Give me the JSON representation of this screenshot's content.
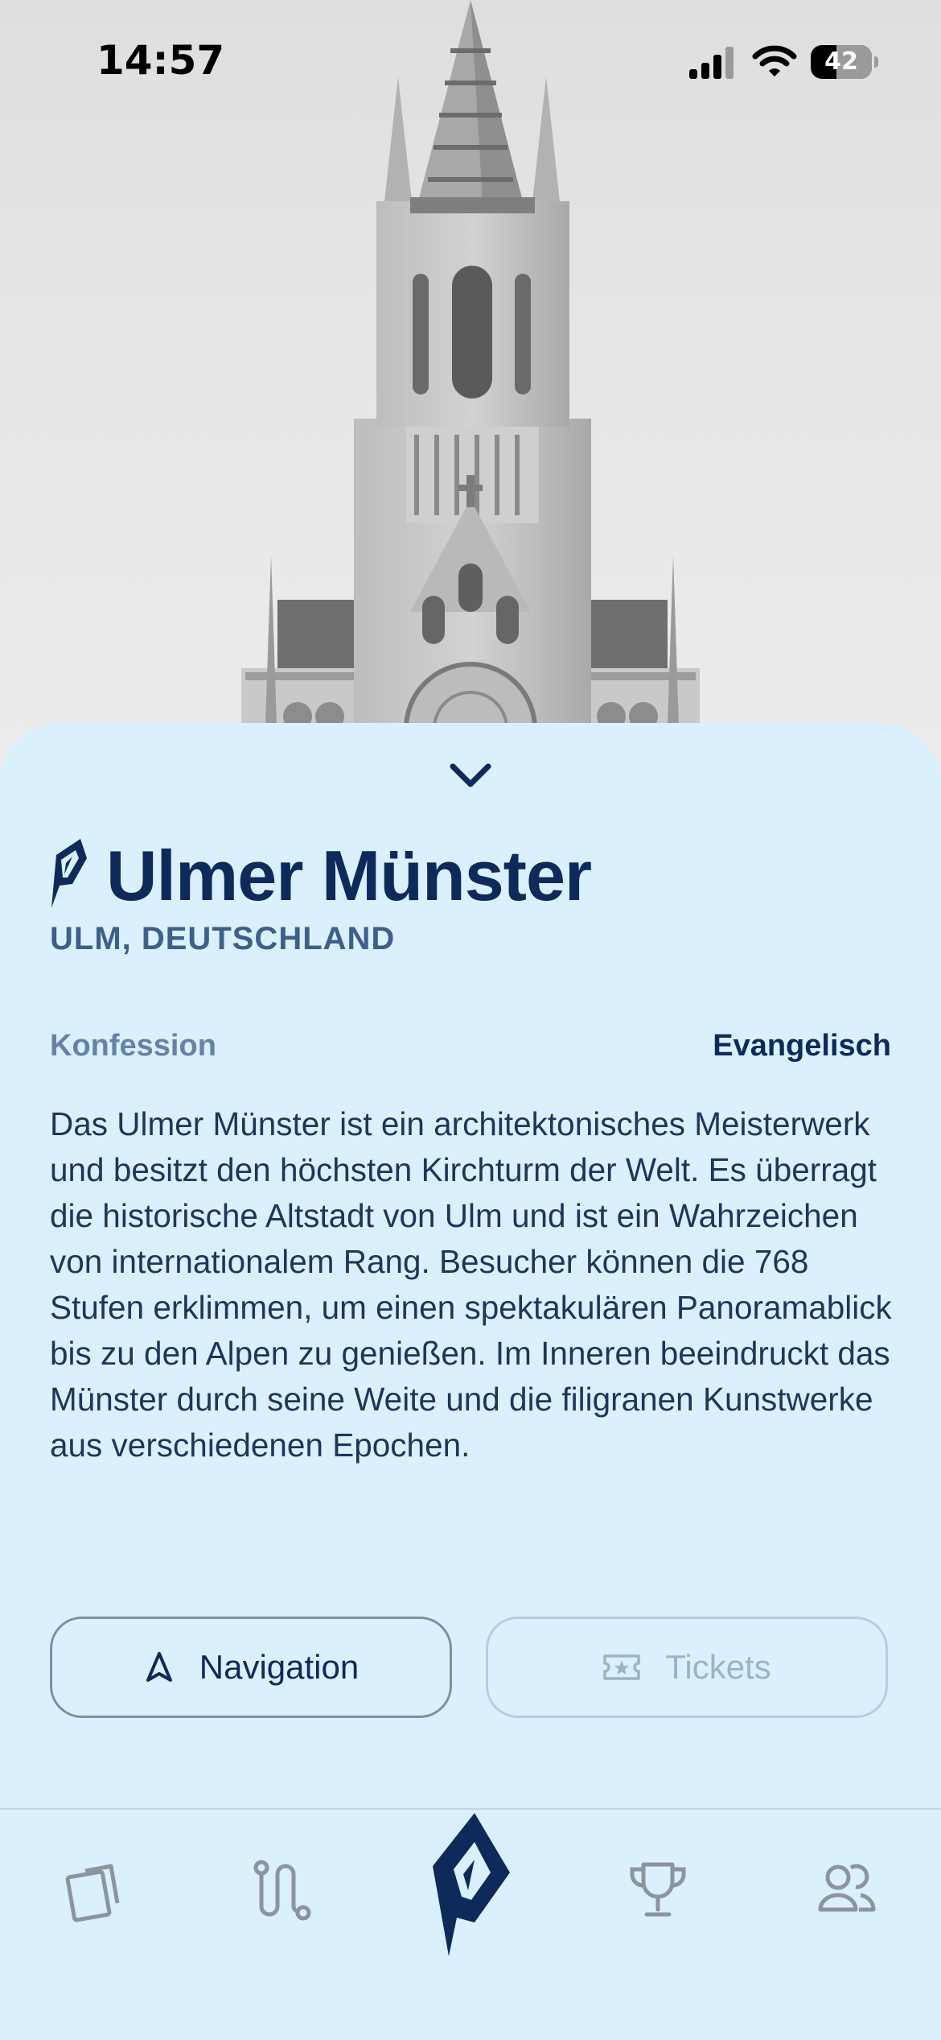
{
  "status_bar": {
    "time": "14:57",
    "battery": "42",
    "battery_level": 0.42
  },
  "detail": {
    "title": "Ulmer Münster",
    "location": "ULM, DEUTSCHLAND",
    "meta_label": "Konfession",
    "meta_value": "Evangelisch",
    "description": "Das Ulmer Münster ist ein architektonisches Meisterwerk und besitzt den höchsten Kirchturm der Welt. Es überragt die historische Altstadt von Ulm und ist ein Wahrzeichen von internationalem Rang. Besucher können die 768 Stufen erklimmen, um einen spektakulären Panoramablick bis zu den Alpen zu genießen. Im Inneren beeindruckt das Münster durch seine Weite und die filigranen Kunstwerke aus verschiedenen Epochen."
  },
  "actions": {
    "navigation_label": "Navigation",
    "tickets_label": "Tickets"
  },
  "tabbar": {
    "items": [
      "cards-icon",
      "route-icon",
      "app-logo-icon",
      "trophy-icon",
      "friends-icon"
    ]
  },
  "colors": {
    "sheet_background": "#dbf0fd",
    "title": "#0d2a5a",
    "subtitle": "#3d5f88",
    "disabled": "#9bb3c8"
  }
}
